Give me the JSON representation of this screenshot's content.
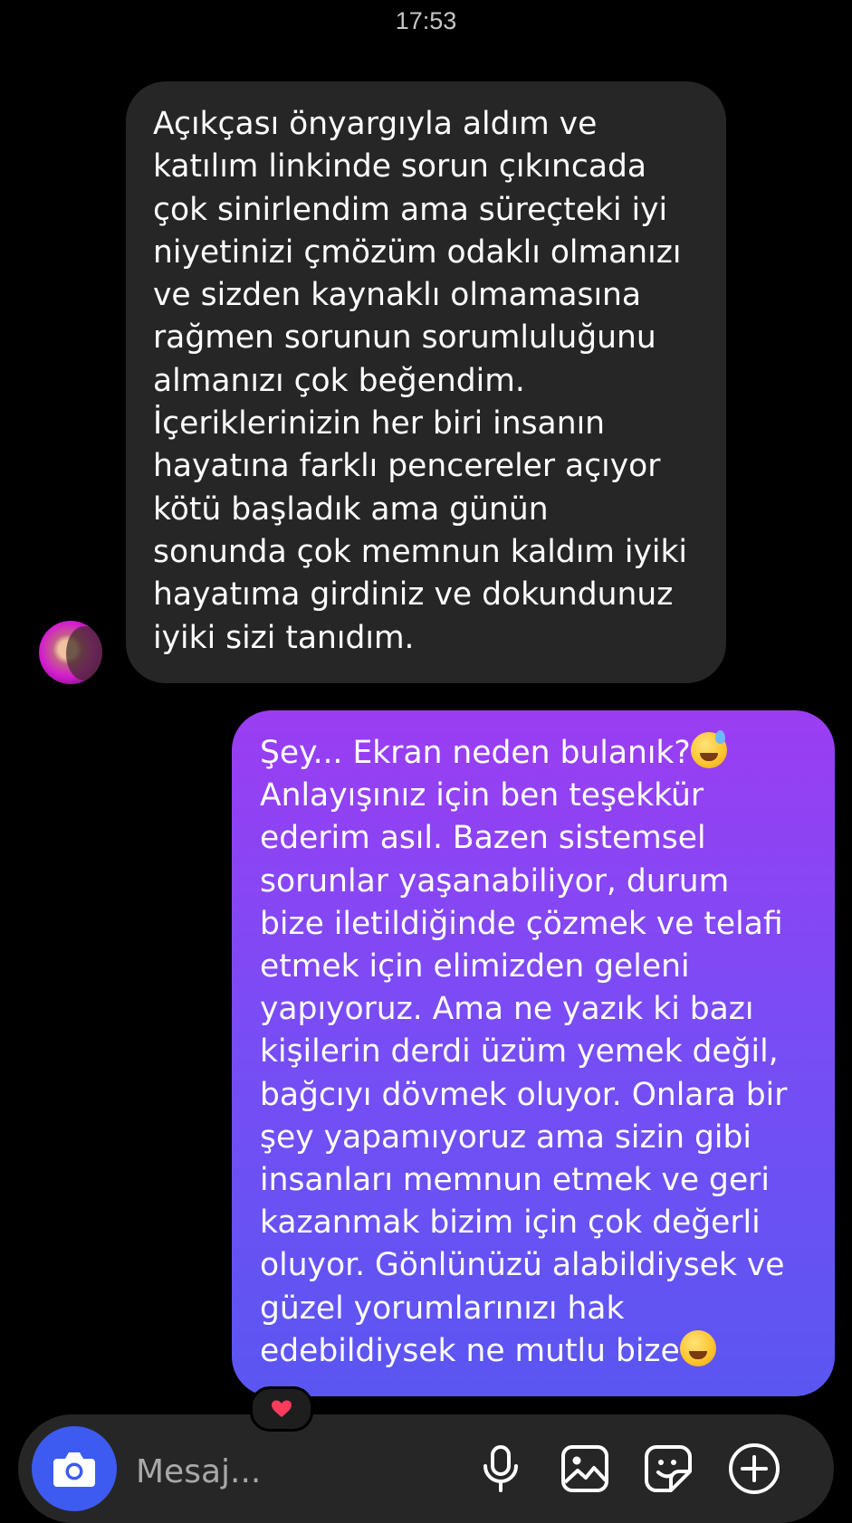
{
  "status": {
    "time": "17:53"
  },
  "thread": {
    "incoming_message": {
      "text": "Açıkçası önyargıyla aldım ve\nkatılım linkinde sorun çıkıncada\nçok sinirlendim ama süreçteki iyi\nniyetinizi çmözüm odaklı olmanızı\nve sizden kaynaklı olmamasına\nrağmen sorunun sorumluluğunu\nalmanızı çok beğendim.\nİçeriklerinizin her biri insanın\nhayatına farklı pencereler açıyor\nkötü başladık ama günün\nsonunda çok memnun kaldım iyiki\nhayatıma girdiniz ve dokundunuz\niyiki sizi tanıdım."
    },
    "outgoing_message": {
      "line1": "Şey... Ekran neden bulanık?",
      "body": "Anlayışınız için ben teşekkür\nederim asıl. Bazen sistemsel\nsorunlar yaşanabiliyor, durum\nbize iletildiğinde çözmek ve telafi\netmek için elimizden geleni\nyapıyoruz. Ama ne yazık ki bazı\nkişilerin derdi üzüm yemek değil,\nbağcıyı dövmek oluyor. Onlara bir\nşey yapamıyoruz ama sizin gibi\ninsanları memnun etmek ve geri\nkazanmak bizim için çok değerli\noluyor. Gönlünüzü alabildiysek ve\ngüzel yorumlarınızı hak\n",
      "last_line": "edebildiysek ne mutlu bize",
      "first_emoji": "grinning-sweat-emoji",
      "last_emoji": "smiling-eyes-emoji"
    },
    "reaction": "heart-icon"
  },
  "composer": {
    "placeholder": "Mesaj...",
    "buttons": [
      "camera-icon",
      "microphone-icon",
      "gallery-icon",
      "sticker-icon",
      "plus-icon"
    ]
  },
  "colors": {
    "background": "#000000",
    "incoming_bubble": "#262626",
    "outgoing_gradient_top": "#9b3df2",
    "outgoing_gradient_bottom": "#5a56f2",
    "camera_button": "#3d5bf1",
    "composer": "#262626",
    "heart": "#ff3b5c"
  }
}
